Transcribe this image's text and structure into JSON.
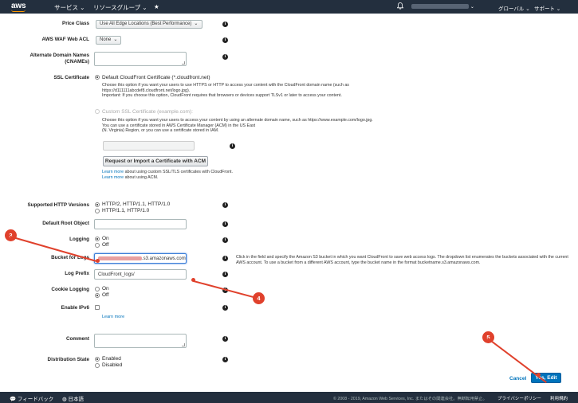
{
  "nav": {
    "logo": "aws",
    "services": "サービス ⌄",
    "resource_groups": "リソースグループ ⌄",
    "pin": "★",
    "region": "グローバル ⌄",
    "support": "サポート ⌄"
  },
  "form": {
    "price_class": {
      "label": "Price Class",
      "value": "Use All Edge Locations (Best Performance)"
    },
    "waf": {
      "label": "AWS WAF Web ACL",
      "value": "None"
    },
    "cnames": {
      "label": "Alternate Domain Names (CNAMEs)"
    },
    "ssl": {
      "label": "SSL Certificate",
      "default_option": "Default CloudFront Certificate (*.cloudfront.net)",
      "default_desc_1": "Choose this option if you want your users to use HTTPS or HTTP to access your content with the CloudFront domain name (such as",
      "default_desc_2": "https://d111111abcdef8.cloudfront.net/logo.jpg).",
      "default_desc_3": "Important: If you choose this option, CloudFront requires that browsers or devices support TLSv1 or later to access your content.",
      "custom_option": "Custom SSL Certificate (example.com):",
      "custom_desc_1": "Choose this option if you want your users to access your content by using an alternate domain name, such as https://www.example.com/logo.jpg.",
      "custom_desc_2": "You can use a certificate stored in AWS Certificate Manager (ACM) in the US East",
      "custom_desc_3": "(N. Virginia) Region, or you can use a certificate stored in IAM.",
      "acm_button": "Request or Import a Certificate with ACM",
      "learn_more_1": "Learn more",
      "learn_more_1_tail": " about using custom SSL/TLS certificates with CloudFront.",
      "learn_more_2": "Learn more",
      "learn_more_2_tail": " about using ACM."
    },
    "http_versions": {
      "label": "Supported HTTP Versions",
      "opt1": "HTTP/2, HTTP/1.1, HTTP/1.0",
      "opt2": "HTTP/1.1, HTTP/1.0"
    },
    "root_object": {
      "label": "Default Root Object"
    },
    "logging": {
      "label": "Logging",
      "on": "On",
      "off": "Off"
    },
    "bucket": {
      "label": "Bucket for Logs",
      "value_suffix": ".s3.amazonaws.com",
      "help": "Click in the field and specify the Amazon S3 bucket in which you want CloudFront to save web access logs. The dropdown list enumerates the buckets associated with the current AWS account. To use a bucket from a different AWS account, type the bucket name in the format bucketname.s3.amazonaws.com."
    },
    "log_prefix": {
      "label": "Log Prefix",
      "value": "CloudFront_logs/"
    },
    "cookie_logging": {
      "label": "Cookie Logging",
      "on": "On",
      "off": "Off"
    },
    "ipv6": {
      "label": "Enable IPv6",
      "learn_more": "Learn more"
    },
    "comment": {
      "label": "Comment"
    },
    "distribution_state": {
      "label": "Distribution State",
      "enabled": "Enabled",
      "disabled": "Disabled"
    },
    "cancel": "Cancel",
    "submit": "Yes, Edit"
  },
  "annotations": {
    "a3": "3",
    "a4": "4",
    "a5": "5",
    "color": "#e0412c"
  },
  "footer": {
    "feedback": "フィードバック",
    "language": "日本語",
    "copyright": "© 2008 - 2019, Amazon Web Services, Inc. またはその関連会社。無断転用禁止。",
    "privacy": "プライバシーポリシー",
    "terms": "利用規約"
  }
}
